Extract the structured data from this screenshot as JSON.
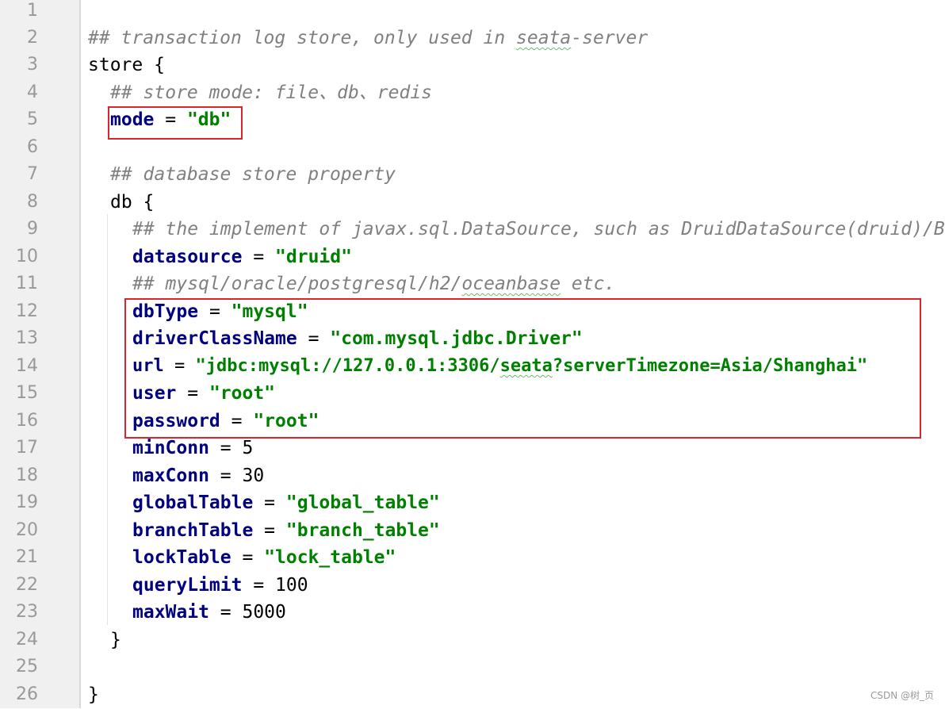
{
  "editor": {
    "line_numbers": [
      "1",
      "2",
      "3",
      "4",
      "5",
      "6",
      "7",
      "8",
      "9",
      "10",
      "11",
      "12",
      "13",
      "14",
      "15",
      "16",
      "17",
      "18",
      "19",
      "20",
      "21",
      "22",
      "23",
      "24",
      "25",
      "26"
    ],
    "lines": {
      "l2": {
        "comment_a": "## transaction log store, only used in ",
        "comment_b": "seata",
        "comment_c": "-server"
      },
      "l3": {
        "text": "store {"
      },
      "l4": {
        "comment": "## store mode: file、db、redis"
      },
      "l5": {
        "key": "mode",
        "op": " = ",
        "value": "\"db\""
      },
      "l7": {
        "comment": "## database store property"
      },
      "l8": {
        "text": "db {"
      },
      "l9": {
        "comment": "## the implement of javax.sql.DataSource, such as DruidDataSource(druid)/B"
      },
      "l10": {
        "key": "datasource",
        "op": " = ",
        "value": "\"druid\""
      },
      "l11": {
        "comment_a": "## mysql/oracle/postgresql/h2/",
        "comment_b": "oceanbase",
        "comment_c": " etc."
      },
      "l12": {
        "key": "dbType",
        "op": " = ",
        "value": "\"mysql\""
      },
      "l13": {
        "key": "driverClassName",
        "op": " = ",
        "value": "\"com.mysql.jdbc.Driver\""
      },
      "l14": {
        "key": "url",
        "op": " = ",
        "value_a": "\"jdbc:mysql://127.0.0.1:3306/",
        "value_b": "seata",
        "value_c": "?serverTimezone=Asia/Shanghai\""
      },
      "l15": {
        "key": "user",
        "op": " = ",
        "value": "\"root\""
      },
      "l16": {
        "key": "password",
        "op": " = ",
        "value": "\"root\""
      },
      "l17": {
        "key": "minConn",
        "op": " = ",
        "value": "5"
      },
      "l18": {
        "key": "maxConn",
        "op": " = ",
        "value": "30"
      },
      "l19": {
        "key": "globalTable",
        "op": " = ",
        "value": "\"global_table\""
      },
      "l20": {
        "key": "branchTable",
        "op": " = ",
        "value": "\"branch_table\""
      },
      "l21": {
        "key": "lockTable",
        "op": " = ",
        "value": "\"lock_table\""
      },
      "l22": {
        "key": "queryLimit",
        "op": " = ",
        "value": "100"
      },
      "l23": {
        "key": "maxWait",
        "op": " = ",
        "value": "5000"
      },
      "l24": {
        "text": "}"
      },
      "l26": {
        "text": "}"
      }
    }
  },
  "watermark": "CSDN @树_页",
  "colors": {
    "key": "#000080",
    "string": "#008000",
    "comment": "#808080",
    "highlight": "#d9252e",
    "gutter": "#f0f0f0"
  }
}
